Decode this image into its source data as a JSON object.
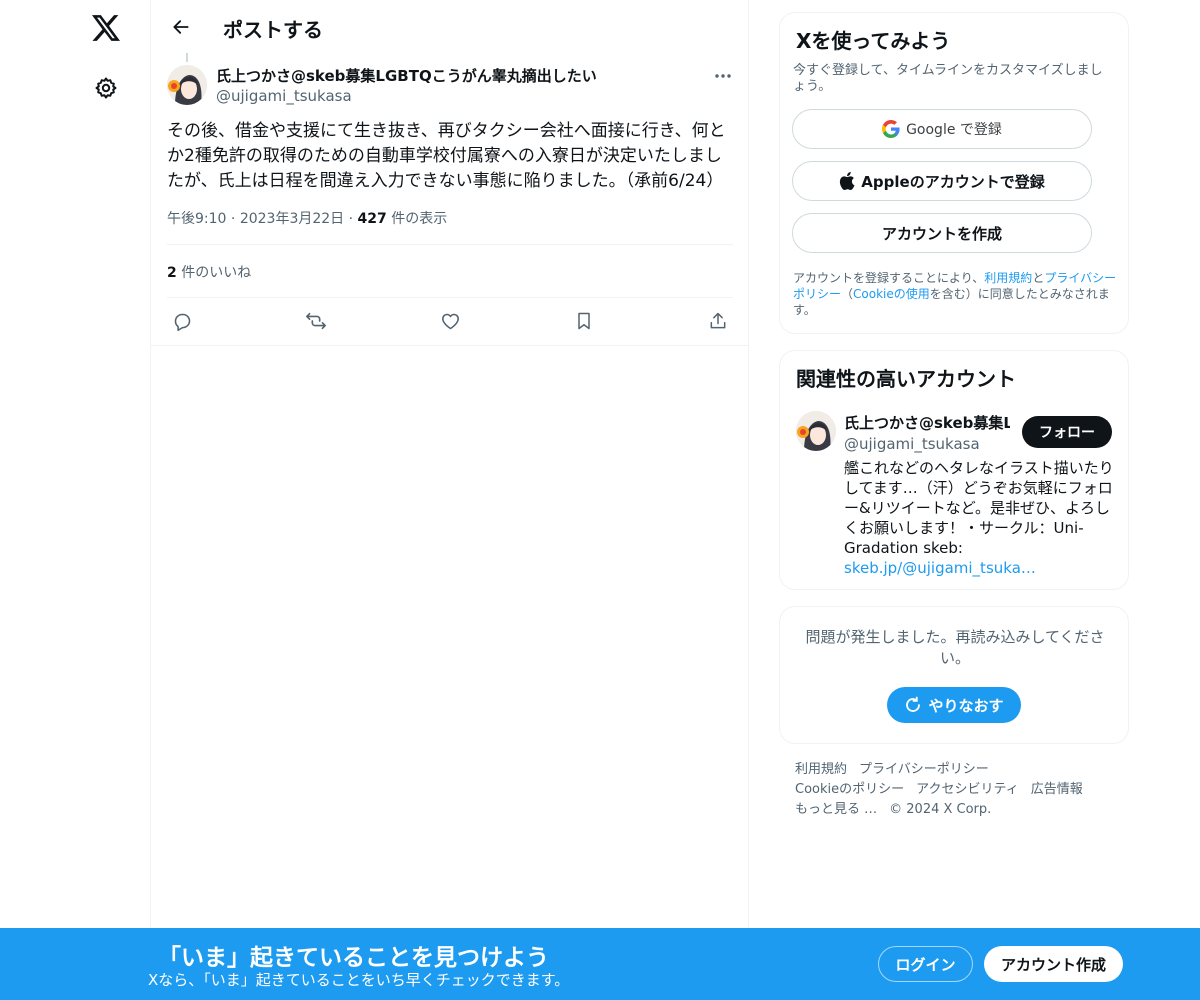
{
  "header": {
    "title": "ポストする"
  },
  "post": {
    "author_name": "氏上つかさ@skeb募集LGBTQこうがん睾丸摘出したい",
    "author_handle": "@ujigami_tsukasa",
    "text": "その後、借金や支援にて生き抜き、再びタクシー会社へ面接に行き、何とか2種免許の取得のための自動車学校付属寮への入寮日が決定いたしましたが、氏上は日程を間違え入力できない事態に陥りました。（承前6/24）",
    "time": "午後9:10",
    "date": "2023年3月22日",
    "views_count": "427",
    "views_label": "件の表示",
    "separator": "·",
    "likes_count": "2",
    "likes_label": "件のいいね"
  },
  "signup": {
    "title": "Xを使ってみよう",
    "subtitle": "今すぐ登録して、タイムラインをカスタマイズしましょう。",
    "google_label": "Google で登録",
    "apple_label": "Appleのアカウントで登録",
    "create_label": "アカウントを作成",
    "legal_prefix": "アカウントを登録することにより、",
    "terms_link": "利用規約",
    "and": "と",
    "privacy_link": "プライバシーポリシー",
    "paren_open": "（",
    "cookie_link": "Cookieの使用",
    "legal_suffix": "を含む）に同意したとみなされます。"
  },
  "related": {
    "title": "関連性の高いアカウント",
    "name": "氏上つかさ@skeb募集LGBTQこうがん睾丸摘出したい",
    "handle": "@ujigami_tsukasa",
    "follow_label": "フォロー",
    "bio": "艦これなどのヘタレなイラスト描いたりしてます…（汗）どうぞお気軽にフォロー&リツイートなど。是非ぜひ、よろしくお願いします！・サークル：Uni-Gradation skeb: ",
    "bio_link": "skeb.jp/@ujigami_tsuka…"
  },
  "error": {
    "message": "問題が発生しました。再読み込みしてください。",
    "retry_label": "やりなおす"
  },
  "footer": {
    "terms": "利用規約",
    "privacy": "プライバシーポリシー",
    "cookie": "Cookieのポリシー",
    "accessibility": "アクセシビリティ",
    "ads": "広告情報",
    "more": "もっと見る …",
    "copyright": "© 2024 X Corp."
  },
  "bottom_bar": {
    "title": "「いま」起きていることを見つけよう",
    "subtitle": "Xなら、「いま」起きていることをいち早くチェックできます。",
    "login_label": "ログイン",
    "create_label": "アカウント作成"
  },
  "colors": {
    "accent": "#1d9bf0",
    "text": "#0f1419",
    "secondary": "#536471",
    "border": "#eff3f4"
  }
}
